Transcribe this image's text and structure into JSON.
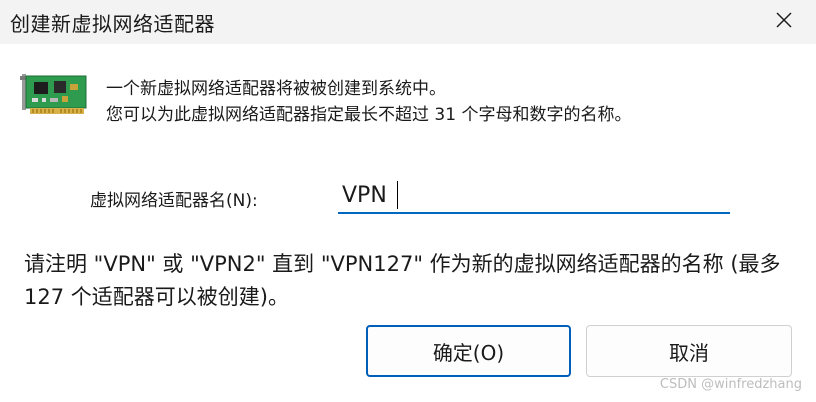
{
  "window": {
    "title": "创建新虚拟网络适配器"
  },
  "intro": {
    "line1": "一个新虚拟网络适配器将被被创建到系统中。",
    "line2": "您可以为此虚拟网络适配器指定最长不超过 31 个字母和数字的名称。"
  },
  "form": {
    "name_label": "虚拟网络适配器名(N):",
    "name_value": "VPN"
  },
  "note": {
    "text": "请注明 \"VPN\" 或 \"VPN2\" 直到 \"VPN127\" 作为新的虚拟网络适配器的名称 (最多 127 个适配器可以被创建)。"
  },
  "buttons": {
    "ok_label": "确定(O)",
    "cancel_label": "取消"
  },
  "watermark": {
    "text": "CSDN @winfredzhang"
  },
  "icons": {
    "close": "close-icon",
    "adapter": "network-adapter-card-icon"
  },
  "colors": {
    "accent": "#005fb8",
    "input_underline": "#0067c0",
    "pcb_green": "#2e9b4e"
  }
}
